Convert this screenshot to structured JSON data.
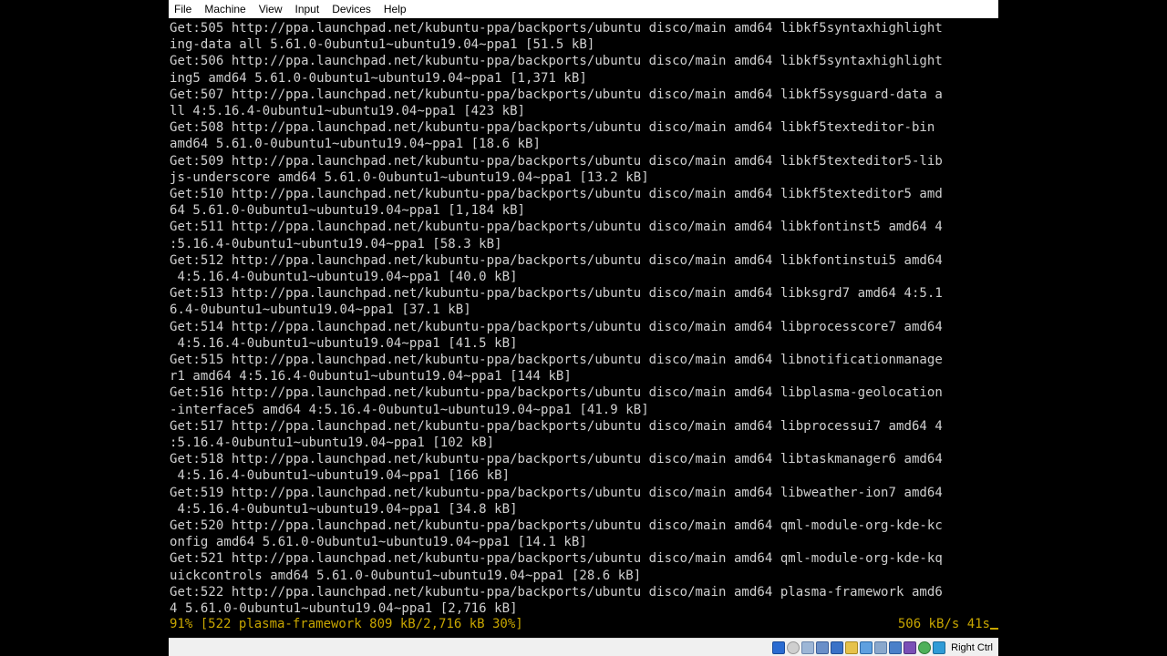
{
  "menubar": {
    "items": [
      "File",
      "Machine",
      "View",
      "Input",
      "Devices",
      "Help"
    ]
  },
  "terminal": {
    "lines": [
      "Get:505 http://ppa.launchpad.net/kubuntu-ppa/backports/ubuntu disco/main amd64 libkf5syntaxhighlight",
      "ing-data all 5.61.0-0ubuntu1~ubuntu19.04~ppa1 [51.5 kB]",
      "Get:506 http://ppa.launchpad.net/kubuntu-ppa/backports/ubuntu disco/main amd64 libkf5syntaxhighlight",
      "ing5 amd64 5.61.0-0ubuntu1~ubuntu19.04~ppa1 [1,371 kB]",
      "Get:507 http://ppa.launchpad.net/kubuntu-ppa/backports/ubuntu disco/main amd64 libkf5sysguard-data a",
      "ll 4:5.16.4-0ubuntu1~ubuntu19.04~ppa1 [423 kB]",
      "Get:508 http://ppa.launchpad.net/kubuntu-ppa/backports/ubuntu disco/main amd64 libkf5texteditor-bin",
      "amd64 5.61.0-0ubuntu1~ubuntu19.04~ppa1 [18.6 kB]",
      "Get:509 http://ppa.launchpad.net/kubuntu-ppa/backports/ubuntu disco/main amd64 libkf5texteditor5-lib",
      "js-underscore amd64 5.61.0-0ubuntu1~ubuntu19.04~ppa1 [13.2 kB]",
      "Get:510 http://ppa.launchpad.net/kubuntu-ppa/backports/ubuntu disco/main amd64 libkf5texteditor5 amd",
      "64 5.61.0-0ubuntu1~ubuntu19.04~ppa1 [1,184 kB]",
      "Get:511 http://ppa.launchpad.net/kubuntu-ppa/backports/ubuntu disco/main amd64 libkfontinst5 amd64 4",
      ":5.16.4-0ubuntu1~ubuntu19.04~ppa1 [58.3 kB]",
      "Get:512 http://ppa.launchpad.net/kubuntu-ppa/backports/ubuntu disco/main amd64 libkfontinstui5 amd64",
      " 4:5.16.4-0ubuntu1~ubuntu19.04~ppa1 [40.0 kB]",
      "Get:513 http://ppa.launchpad.net/kubuntu-ppa/backports/ubuntu disco/main amd64 libksgrd7 amd64 4:5.1",
      "6.4-0ubuntu1~ubuntu19.04~ppa1 [37.1 kB]",
      "Get:514 http://ppa.launchpad.net/kubuntu-ppa/backports/ubuntu disco/main amd64 libprocesscore7 amd64",
      " 4:5.16.4-0ubuntu1~ubuntu19.04~ppa1 [41.5 kB]",
      "Get:515 http://ppa.launchpad.net/kubuntu-ppa/backports/ubuntu disco/main amd64 libnotificationmanage",
      "r1 amd64 4:5.16.4-0ubuntu1~ubuntu19.04~ppa1 [144 kB]",
      "Get:516 http://ppa.launchpad.net/kubuntu-ppa/backports/ubuntu disco/main amd64 libplasma-geolocation",
      "-interface5 amd64 4:5.16.4-0ubuntu1~ubuntu19.04~ppa1 [41.9 kB]",
      "Get:517 http://ppa.launchpad.net/kubuntu-ppa/backports/ubuntu disco/main amd64 libprocessui7 amd64 4",
      ":5.16.4-0ubuntu1~ubuntu19.04~ppa1 [102 kB]",
      "Get:518 http://ppa.launchpad.net/kubuntu-ppa/backports/ubuntu disco/main amd64 libtaskmanager6 amd64",
      " 4:5.16.4-0ubuntu1~ubuntu19.04~ppa1 [166 kB]",
      "Get:519 http://ppa.launchpad.net/kubuntu-ppa/backports/ubuntu disco/main amd64 libweather-ion7 amd64",
      " 4:5.16.4-0ubuntu1~ubuntu19.04~ppa1 [34.8 kB]",
      "Get:520 http://ppa.launchpad.net/kubuntu-ppa/backports/ubuntu disco/main amd64 qml-module-org-kde-kc",
      "onfig amd64 5.61.0-0ubuntu1~ubuntu19.04~ppa1 [14.1 kB]",
      "Get:521 http://ppa.launchpad.net/kubuntu-ppa/backports/ubuntu disco/main amd64 qml-module-org-kde-kq",
      "uickcontrols amd64 5.61.0-0ubuntu1~ubuntu19.04~ppa1 [28.6 kB]",
      "Get:522 http://ppa.launchpad.net/kubuntu-ppa/backports/ubuntu disco/main amd64 plasma-framework amd6",
      "4 5.61.0-0ubuntu1~ubuntu19.04~ppa1 [2,716 kB]"
    ],
    "progress_status": "91% [522 plasma-framework 809 kB/2,716 kB 30%]",
    "progress_percent": 91,
    "download_rate": "506 kB/s 41s",
    "text_color": "#d0d0d0",
    "status_color": "#c8a600"
  },
  "statusbar": {
    "icons": [
      "hard-disk-icon",
      "optical-drive-icon",
      "audio-icon",
      "network-icon",
      "usb-icon",
      "shared-folders-icon",
      "display-icon",
      "video-capture-icon",
      "cpu-icon",
      "virtualization-icon",
      "guest-additions-icon",
      "mouse-integration-icon"
    ],
    "host_key_label": "Right Ctrl"
  }
}
